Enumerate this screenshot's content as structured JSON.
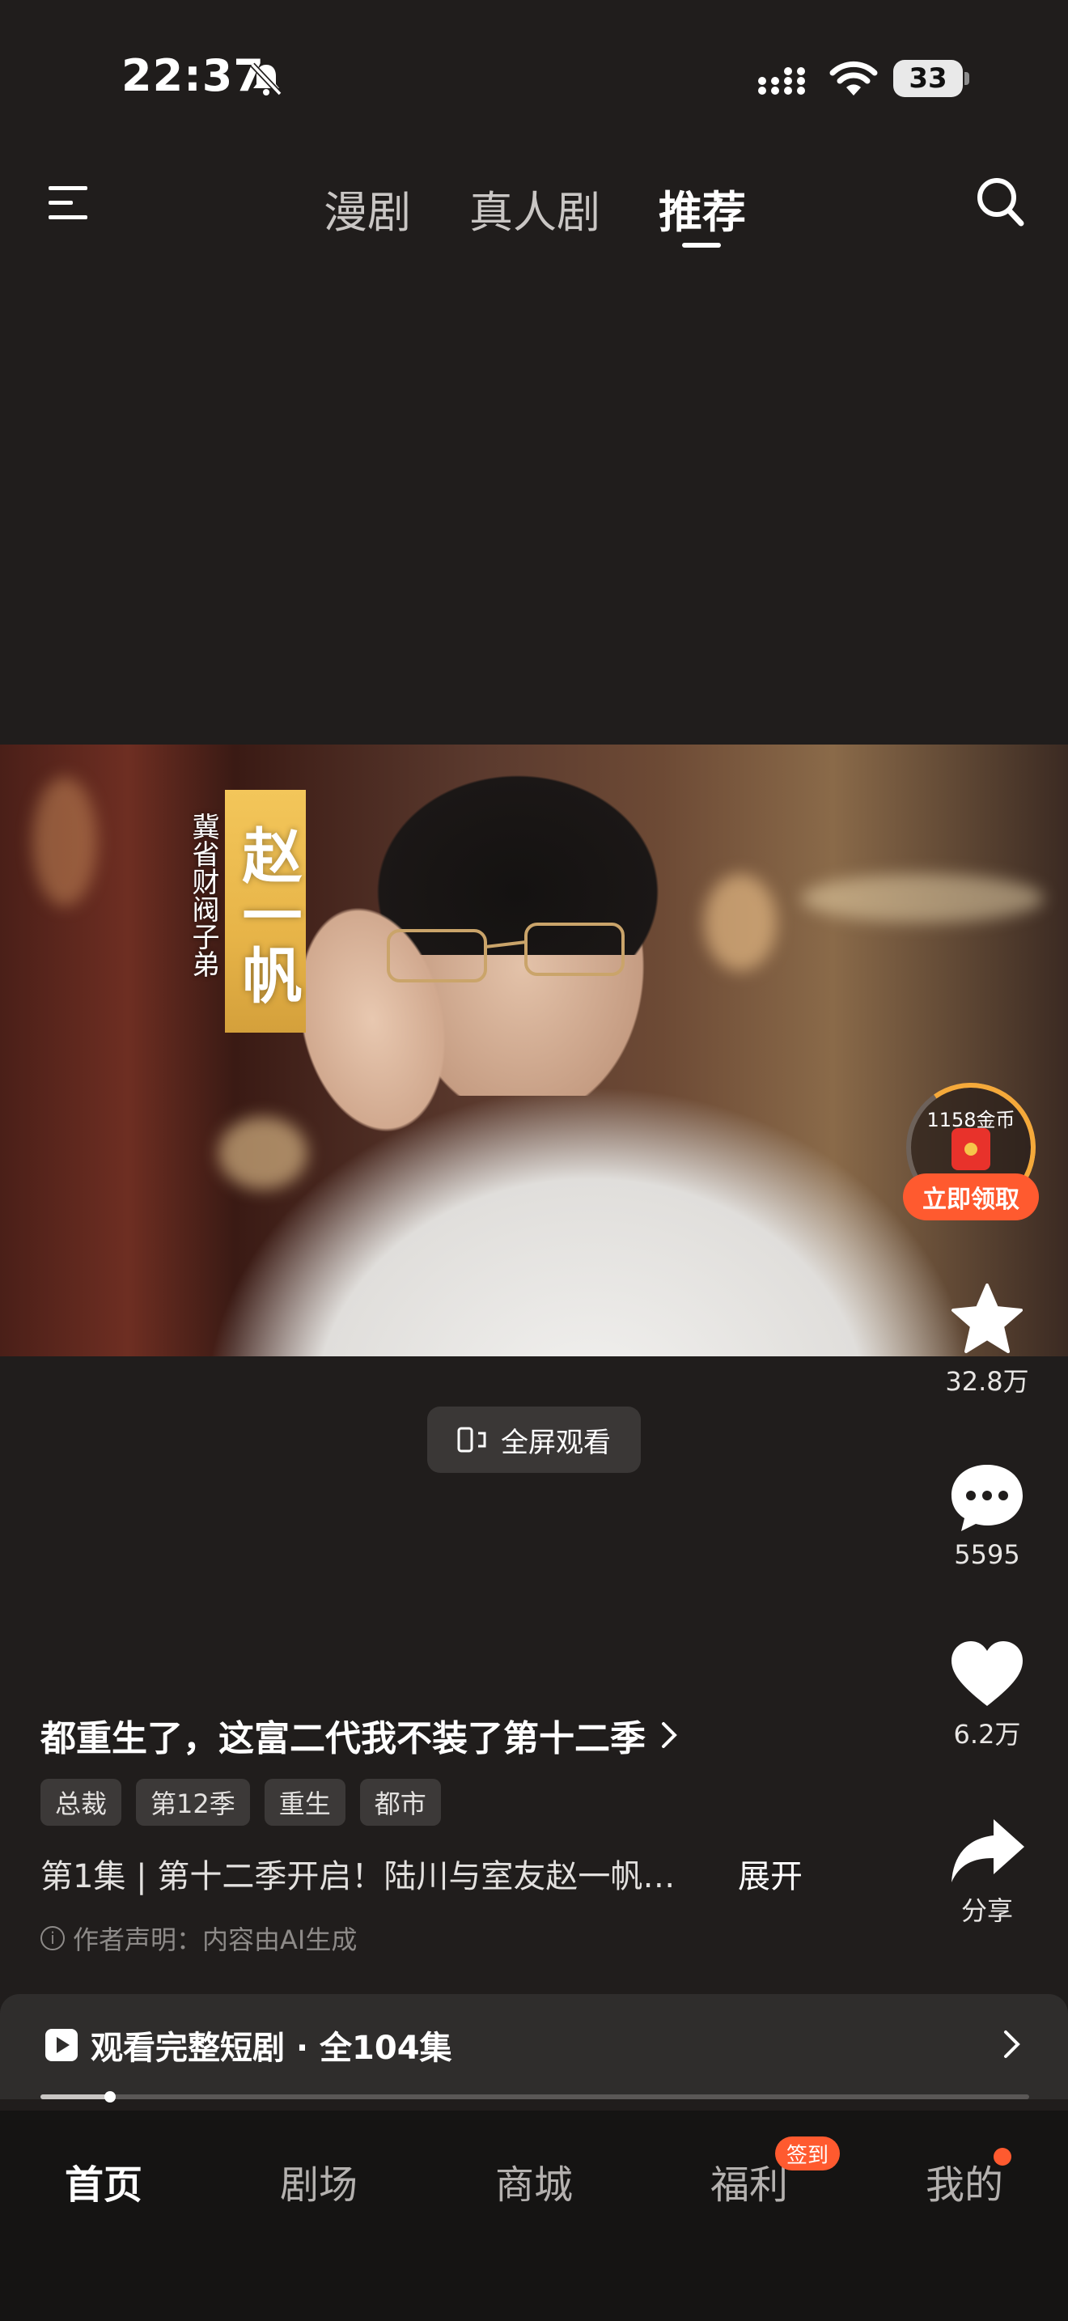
{
  "status_bar": {
    "time": "22:37",
    "battery": "33"
  },
  "top_nav": {
    "tabs": [
      {
        "label": "漫剧",
        "active": false
      },
      {
        "label": "真人剧",
        "active": false
      },
      {
        "label": "推荐",
        "active": true
      }
    ]
  },
  "video": {
    "caption_name": "赵一帆",
    "caption_subtitle": "冀省财阀子弟"
  },
  "reward": {
    "coins": "1158金币",
    "button": "立即领取"
  },
  "actions": {
    "favorite_count": "32.8万",
    "comment_count": "5595",
    "like_count": "6.2万",
    "share_label": "分享"
  },
  "fullscreen_label": "全屏观看",
  "drama": {
    "title": "都重生了，这富二代我不装了第十二季",
    "tags": [
      "总裁",
      "第12季",
      "重生",
      "都市"
    ],
    "episode_desc": "第1集 | 第十二季开启！陆川与室友赵一帆…",
    "expand": "展开",
    "ai_note": "作者声明：内容由AI生成"
  },
  "watch_full": {
    "label": "观看完整短剧 · 全104集",
    "progress": 0.07
  },
  "bottom_nav": {
    "items": [
      {
        "label": "首页",
        "active": true
      },
      {
        "label": "剧场",
        "active": false
      },
      {
        "label": "商城",
        "active": false
      },
      {
        "label": "福利",
        "active": false
      },
      {
        "label": "我的",
        "active": false
      }
    ],
    "welfare_badge": "签到"
  },
  "colors": {
    "background": "#201d1c",
    "accent": "#ff5a2f",
    "bottom_nav_bg": "#151413"
  }
}
